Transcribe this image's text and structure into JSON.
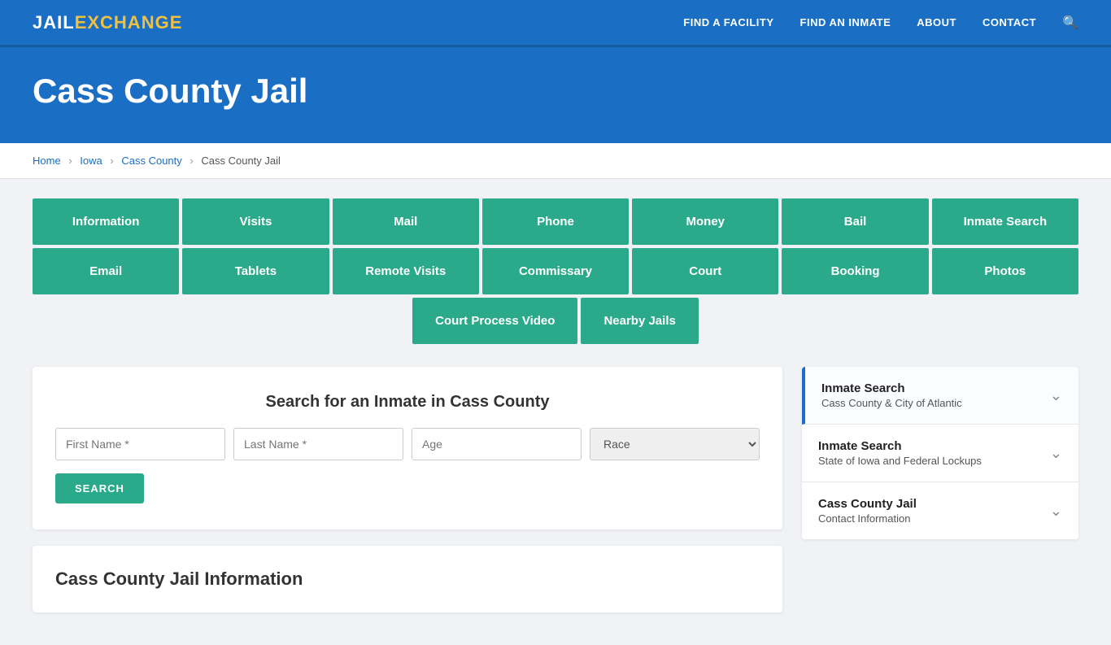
{
  "site": {
    "logo_part1": "JAIL",
    "logo_part2": "EXCHANGE"
  },
  "nav": {
    "links": [
      {
        "label": "FIND A FACILITY",
        "name": "nav-find-facility"
      },
      {
        "label": "FIND AN INMATE",
        "name": "nav-find-inmate"
      },
      {
        "label": "ABOUT",
        "name": "nav-about"
      },
      {
        "label": "CONTACT",
        "name": "nav-contact"
      }
    ]
  },
  "hero": {
    "title": "Cass County Jail"
  },
  "breadcrumb": {
    "items": [
      {
        "label": "Home",
        "name": "breadcrumb-home"
      },
      {
        "label": "Iowa",
        "name": "breadcrumb-iowa"
      },
      {
        "label": "Cass County",
        "name": "breadcrumb-cass-county"
      },
      {
        "label": "Cass County Jail",
        "name": "breadcrumb-cass-county-jail"
      }
    ]
  },
  "grid_buttons_row1": [
    "Information",
    "Visits",
    "Mail",
    "Phone",
    "Money",
    "Bail",
    "Inmate Search"
  ],
  "grid_buttons_row2": [
    "Email",
    "Tablets",
    "Remote Visits",
    "Commissary",
    "Court",
    "Booking",
    "Photos"
  ],
  "grid_buttons_row3": [
    "Court Process Video",
    "Nearby Jails"
  ],
  "search": {
    "title": "Search for an Inmate in Cass County",
    "first_name_placeholder": "First Name *",
    "last_name_placeholder": "Last Name *",
    "age_placeholder": "Age",
    "race_placeholder": "Race",
    "button_label": "SEARCH"
  },
  "info_section": {
    "title": "Cass County Jail Information"
  },
  "sidebar": {
    "items": [
      {
        "title": "Inmate Search",
        "subtitle": "Cass County & City of Atlantic",
        "active": true
      },
      {
        "title": "Inmate Search",
        "subtitle": "State of Iowa and Federal Lockups",
        "active": false
      },
      {
        "title": "Cass County Jail",
        "subtitle": "Contact Information",
        "active": false
      }
    ]
  }
}
